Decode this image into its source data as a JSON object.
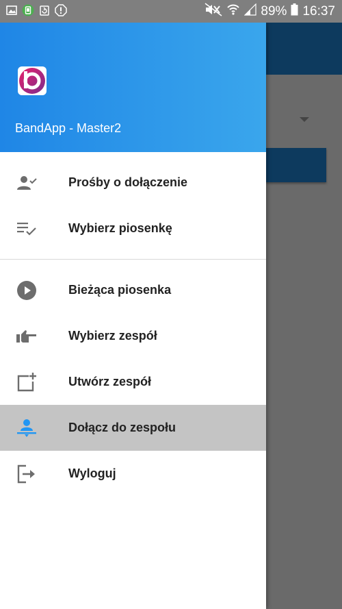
{
  "status_bar": {
    "left_icons": [
      "image-icon",
      "android-debug-icon",
      "recycle-icon",
      "alert-icon"
    ],
    "right_icons": [
      "mute-icon",
      "wifi-icon",
      "signal-icon"
    ],
    "battery": "89%",
    "time": "16:37"
  },
  "drawer": {
    "app_title": "BandApp - Master2",
    "groups": [
      [
        {
          "label": "Prośby o dołączenie",
          "icon": "person-check-icon"
        },
        {
          "label": "Wybierz piosenkę",
          "icon": "playlist-check-icon"
        }
      ],
      [
        {
          "label": "Bieżąca piosenka",
          "icon": "play-circle-icon"
        },
        {
          "label": "Wybierz zespół",
          "icon": "hand-point-icon"
        },
        {
          "label": "Utwórz zespół",
          "icon": "add-box-icon"
        },
        {
          "label": "Dołącz do zespołu",
          "icon": "person-join-icon",
          "selected": true
        },
        {
          "label": "Wyloguj",
          "icon": "logout-icon"
        }
      ]
    ]
  },
  "colors": {
    "header_start": "#1f86e6",
    "header_end": "#3aa6ec",
    "selected_bg": "#c4c4c4",
    "selected_icon": "#2196f3",
    "icon": "#6d6d6d",
    "logo_gradient": [
      "#e7206b",
      "#7b2d8e"
    ]
  }
}
